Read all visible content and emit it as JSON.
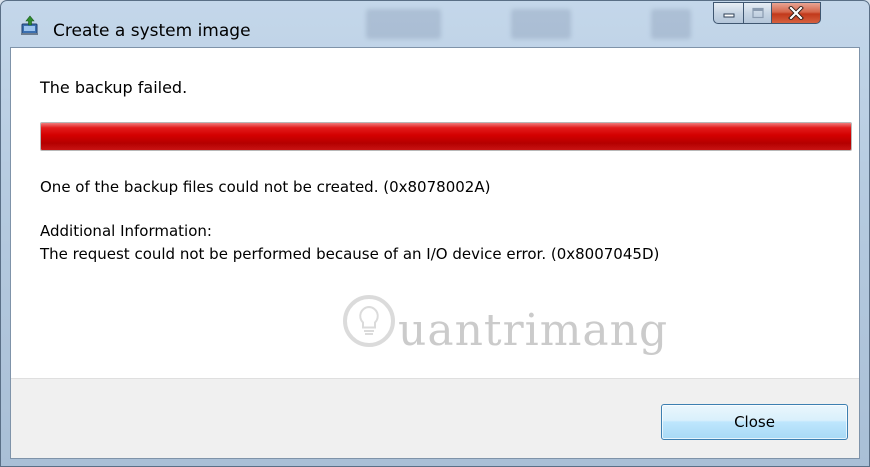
{
  "window": {
    "title": "Create a system image",
    "icon": "backup-icon"
  },
  "caption_buttons": {
    "minimize_icon": "minimize-icon",
    "maximize_icon": "maximize-icon",
    "close_icon": "close-icon"
  },
  "content": {
    "headline": "The backup failed.",
    "progress": 1.0,
    "progress_color": "#d40000",
    "error_message": "One of the backup files could not be created. (0x8078002A)",
    "additional_label": "Additional Information:",
    "additional_message": "The request could not be performed because of an I/O device error. (0x8007045D)"
  },
  "watermark": {
    "text": "uantrimang",
    "icon": "lightbulb-icon"
  },
  "footer": {
    "close_label": "Close"
  }
}
